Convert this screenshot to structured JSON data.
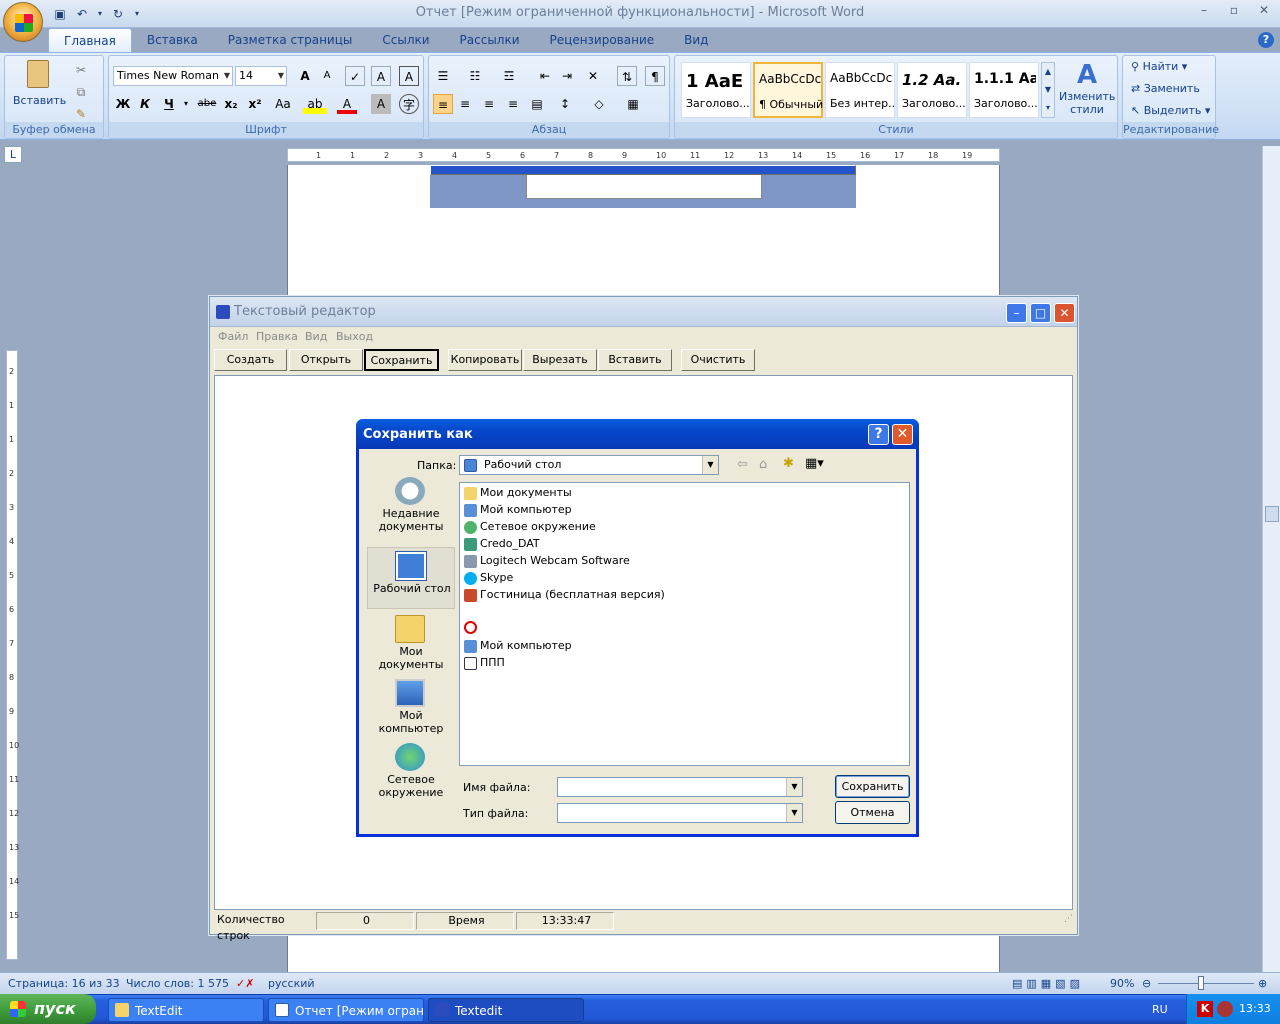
{
  "word": {
    "title": "Отчет [Режим ограниченной функциональности]  -  Microsoft Word",
    "tabs": [
      "Главная",
      "Вставка",
      "Разметка страницы",
      "Ссылки",
      "Рассылки",
      "Рецензирование",
      "Вид"
    ],
    "help": "?",
    "clipboard": {
      "paste_label": "Вставить",
      "group": "Буфер обмена"
    },
    "font": {
      "name": "Times New Roman",
      "size": "14",
      "group": "Шрифт",
      "bold": "Ж",
      "italic": "К",
      "underline": "Ч",
      "strike": "abe",
      "sub": "x₂",
      "sup": "x²",
      "case": "Aa",
      "grow": "A",
      "shrink": "A",
      "clear": "A",
      "color": "A",
      "highlight": "ab"
    },
    "paragraph": {
      "group": "Абзац"
    },
    "styles": {
      "group": "Стили",
      "items": [
        {
          "preview": "1  АаЕ",
          "name": "Заголово..."
        },
        {
          "preview": "АаВbCcDc",
          "name": "¶ Обычный"
        },
        {
          "preview": "АаВbCcDc",
          "name": "Без интер..."
        },
        {
          "preview": "1.2  Аа.",
          "name": "Заголово..."
        },
        {
          "preview": "1.1.1  Аа",
          "name": "Заголово..."
        }
      ],
      "change_label": "Изменить стили"
    },
    "editing": {
      "group": "Редактирование",
      "find": "Найти",
      "replace": "Заменить",
      "select": "Выделить"
    },
    "ruler_ticks": [
      "1",
      "1",
      "2",
      "3",
      "4",
      "5",
      "6",
      "7",
      "8",
      "9",
      "10",
      "11",
      "12",
      "13",
      "14",
      "15",
      "16",
      "17",
      "18",
      "19"
    ],
    "vruler_ticks": [
      "2",
      "1",
      "1",
      "2",
      "3",
      "4",
      "5",
      "6",
      "7",
      "8",
      "9",
      "10",
      "11",
      "12",
      "13",
      "14",
      "15"
    ],
    "status": {
      "page": "Страница: 16 из 33",
      "words": "Число слов: 1 575",
      "lang": "русский",
      "zoom": "90%"
    }
  },
  "taskbar": {
    "start": "пуск",
    "items": [
      "TextEdit",
      "Отчет [Режим огран...",
      "Textedit"
    ],
    "lang": "RU",
    "clock": "13:33"
  },
  "editor": {
    "title": "Текстовый редактор",
    "menu": [
      "Файл",
      "Правка",
      "Вид",
      "Выход"
    ],
    "buttons": [
      "Создать",
      "Открыть",
      "Сохранить",
      "Копировать",
      "Вырезать",
      "Вставить",
      "Очистить"
    ],
    "status": {
      "lines_label": "Количество строк",
      "lines_value": "0",
      "time_label": "Время",
      "time_value": "13:33:47"
    }
  },
  "dialog": {
    "title": "Сохранить как",
    "folder_label": "Папка:",
    "folder_value": "Рабочий стол",
    "places": [
      "Недавние документы",
      "Рабочий стол",
      "Мои документы",
      "Мой компьютер",
      "Сетевое окружение"
    ],
    "files": [
      "Мои документы",
      "Мой компьютер",
      "Сетевое окружение",
      "Credo_DAT",
      "Logitech Webcam Software",
      "Skype",
      "Гостиница (бесплатная версия)",
      "",
      "Мой компьютер",
      "ППП"
    ],
    "filename_label": "Имя файла:",
    "filename_value": "",
    "filetype_label": "Тип файла:",
    "filetype_value": "",
    "save_button": "Сохранить",
    "cancel_button": "Отмена"
  }
}
